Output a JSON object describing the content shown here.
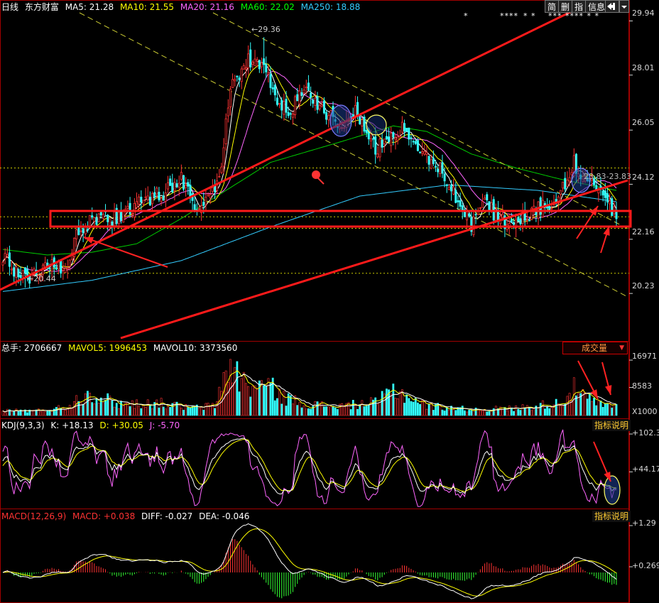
{
  "header": {
    "period": "日线",
    "stock": "东方财富",
    "ma": [
      {
        "label": "MA5: 21.28",
        "color": "#ffffff"
      },
      {
        "label": "MA10: 21.55",
        "color": "#ffff00"
      },
      {
        "label": "MA20: 21.16",
        "color": "#ff66ff"
      },
      {
        "label": "MA60: 22.02",
        "color": "#00ff00"
      },
      {
        "label": "MA250: 18.88",
        "color": "#33ccff"
      }
    ]
  },
  "toolbar": {
    "simple": "简",
    "delete": "删",
    "indicator": "指",
    "info": "信息",
    "exit_icon": "exit-icon",
    "dropdown_icon": "chevron-down-icon"
  },
  "price_axis": {
    "labels": [
      "29.94",
      "28.01",
      "26.05",
      "24.12",
      "22.16",
      "20.23"
    ],
    "min": 18.69,
    "max": 30.23
  },
  "annotations": {
    "high": "←29.36",
    "low": "←20.44",
    "range": "23.83-23.83"
  },
  "stars": [
    {
      "text": "*",
      "x": 653
    },
    {
      "text": "****",
      "x": 704
    },
    {
      "text": "*  *",
      "x": 737
    },
    {
      "text": "***  ****  *  *",
      "x": 772
    }
  ],
  "volume": {
    "header": [
      {
        "label": "总手: 2706667",
        "color": "#ffffff"
      },
      {
        "label": "MAVOL5: 1996453",
        "color": "#ffff00"
      },
      {
        "label": "MAVOL10: 3373560",
        "color": "#ffffff"
      }
    ],
    "selector": "成交量",
    "axis": [
      "16971",
      "8583",
      "X1000"
    ]
  },
  "kdj": {
    "header": [
      {
        "label": "KDJ(9,3,3)",
        "color": "#ffffff"
      },
      {
        "label": "K: +18.13",
        "color": "#ffffff"
      },
      {
        "label": "D: +30.05",
        "color": "#ffff00"
      },
      {
        "label": "J: -5.70",
        "color": "#ff66ff"
      }
    ],
    "button": "指标说明",
    "axis": [
      "+102.3",
      "+44.17"
    ]
  },
  "macd": {
    "header": [
      {
        "label": "MACD(12,26,9)",
        "color": "#ff3333"
      },
      {
        "label": "MACD: +0.038",
        "color": "#ff3333"
      },
      {
        "label": "DIFF: -0.027",
        "color": "#ffffff"
      },
      {
        "label": "DEA: -0.046",
        "color": "#ffffff"
      }
    ],
    "button": "指标说明",
    "axis": [
      "+1.29",
      "+0.269"
    ]
  },
  "chart_data": {
    "type": "candlestick",
    "title": "东方财富 日线",
    "price_ylim": [
      18.69,
      30.23
    ],
    "keypoints": {
      "close": [
        [
          0,
          21.6
        ],
        [
          6,
          21.0
        ],
        [
          12,
          20.8
        ],
        [
          20,
          21.3
        ],
        [
          28,
          21.0
        ],
        [
          33,
          22.3
        ],
        [
          40,
          22.9
        ],
        [
          52,
          22.9
        ],
        [
          62,
          23.5
        ],
        [
          72,
          23.8
        ],
        [
          80,
          24.3
        ],
        [
          86,
          23.4
        ],
        [
          92,
          23.6
        ],
        [
          97,
          24.3
        ],
        [
          102,
          27.6
        ],
        [
          110,
          28.6
        ],
        [
          117,
          28.2
        ],
        [
          123,
          27.1
        ],
        [
          128,
          26.6
        ],
        [
          135,
          27.6
        ],
        [
          140,
          27.1
        ],
        [
          146,
          26.6
        ],
        [
          152,
          26.3
        ],
        [
          158,
          26.9
        ],
        [
          163,
          25.7
        ],
        [
          168,
          25.4
        ],
        [
          174,
          25.9
        ],
        [
          180,
          26.1
        ],
        [
          186,
          25.3
        ],
        [
          192,
          24.9
        ],
        [
          198,
          24.5
        ],
        [
          204,
          23.4
        ],
        [
          210,
          22.6
        ],
        [
          216,
          23.5
        ],
        [
          222,
          22.9
        ],
        [
          228,
          22.7
        ],
        [
          234,
          23.0
        ],
        [
          240,
          23.3
        ],
        [
          246,
          23.4
        ],
        [
          252,
          24.1
        ],
        [
          256,
          25.0
        ],
        [
          260,
          24.1
        ],
        [
          265,
          24.2
        ],
        [
          270,
          23.5
        ],
        [
          275,
          23.0
        ]
      ],
      "volume": [
        [
          0,
          1500
        ],
        [
          15,
          1400
        ],
        [
          28,
          2500
        ],
        [
          38,
          7000
        ],
        [
          52,
          3500
        ],
        [
          70,
          3800
        ],
        [
          85,
          2200
        ],
        [
          95,
          3000
        ],
        [
          101,
          15500
        ],
        [
          110,
          8500
        ],
        [
          118,
          9500
        ],
        [
          126,
          5500
        ],
        [
          135,
          3500
        ],
        [
          150,
          2800
        ],
        [
          168,
          4000
        ],
        [
          175,
          8000
        ],
        [
          190,
          3000
        ],
        [
          210,
          1800
        ],
        [
          230,
          2200
        ],
        [
          250,
          4000
        ],
        [
          256,
          8000
        ],
        [
          262,
          5000
        ],
        [
          268,
          3200
        ],
        [
          275,
          2700
        ]
      ],
      "ma250": [
        [
          0,
          20.3
        ],
        [
          40,
          20.7
        ],
        [
          80,
          21.4
        ],
        [
          120,
          22.6
        ],
        [
          160,
          23.7
        ],
        [
          200,
          24.1
        ],
        [
          240,
          23.9
        ],
        [
          275,
          23.5
        ]
      ],
      "ma60": [
        [
          0,
          21.8
        ],
        [
          20,
          21.6
        ],
        [
          40,
          21.7
        ],
        [
          60,
          22.0
        ],
        [
          80,
          22.9
        ],
        [
          100,
          23.9
        ],
        [
          120,
          24.9
        ],
        [
          150,
          25.6
        ],
        [
          175,
          26.2
        ],
        [
          190,
          26.0
        ],
        [
          210,
          25.2
        ],
        [
          230,
          24.7
        ],
        [
          250,
          24.3
        ],
        [
          275,
          23.9
        ]
      ]
    },
    "series": [
      {
        "name": "MA5",
        "value": 21.28
      },
      {
        "name": "MA10",
        "value": 21.55
      },
      {
        "name": "MA20",
        "value": 21.16
      },
      {
        "name": "MA60",
        "value": 22.02
      },
      {
        "name": "MA250",
        "value": 18.88
      }
    ],
    "high": 29.36,
    "low": 20.44,
    "last": {
      "volume": 2706667,
      "K": 18.13,
      "D": 30.05,
      "J": -5.7,
      "MACD": 0.038,
      "DIFF": -0.027,
      "DEA": -0.046
    }
  }
}
